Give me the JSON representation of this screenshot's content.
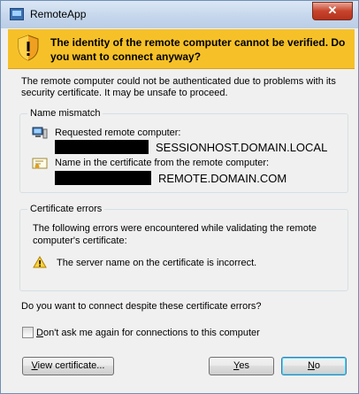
{
  "window": {
    "title": "RemoteApp",
    "close_glyph": "✕"
  },
  "banner": {
    "text": "The identity of the remote computer cannot be verified. Do you want to connect anyway?",
    "icon": "shield-warning-icon",
    "color": "#f6c128"
  },
  "intro": "The remote computer could not be authenticated due to problems with its security certificate. It may be unsafe to proceed.",
  "name_mismatch": {
    "legend": "Name mismatch",
    "requested_label": "Requested remote computer:",
    "requested_value": "SESSIONHOST.DOMAIN.LOCAL",
    "certificate_label": "Name in the certificate from the remote computer:",
    "certificate_value": "REMOTE.DOMAIN.COM"
  },
  "certificate_errors": {
    "legend": "Certificate errors",
    "intro": "The following errors were encountered while validating the remote computer's certificate:",
    "errors": [
      {
        "icon": "warning-icon",
        "text": "The server name on the certificate is incorrect."
      }
    ]
  },
  "question": "Do you want to connect despite these certificate errors?",
  "dont_ask": {
    "label_first": "D",
    "label_rest": "on't ask me again for connections to this computer",
    "checked": false
  },
  "buttons": {
    "view_first": "V",
    "view_rest": "iew certificate...",
    "yes_first": "Y",
    "yes_rest": "es",
    "no_first": "N",
    "no_rest": "o"
  }
}
